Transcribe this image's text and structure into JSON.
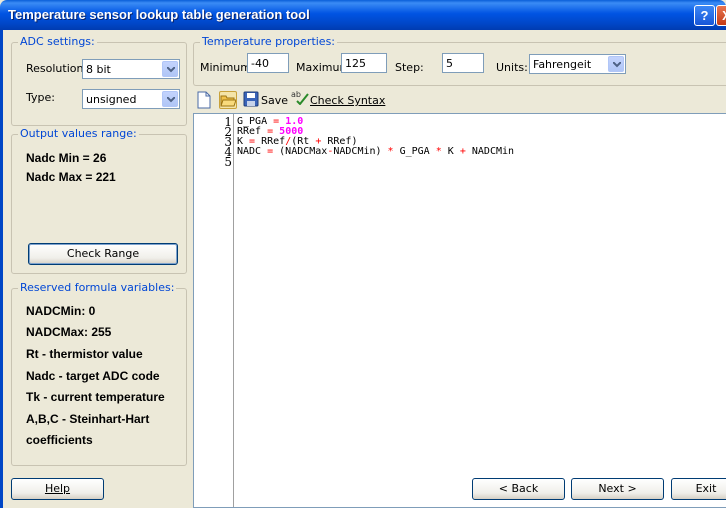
{
  "window": {
    "title": "Temperature sensor lookup table generation tool",
    "help_glyph": "?",
    "close_glyph": "X"
  },
  "adc_settings": {
    "group_title": "ADC settings:",
    "resolution_label": "Resolution:",
    "resolution_value": "8 bit",
    "type_label": "Type:",
    "type_value": "unsigned"
  },
  "output_range": {
    "group_title": "Output values range:",
    "nadc_min": "Nadc Min = 26",
    "nadc_max": "Nadc Max = 221",
    "check_range_label": "Check Range"
  },
  "reserved": {
    "group_title": "Reserved formula variables:",
    "items": [
      "NADCMin: 0",
      "NADCMax: 255",
      "Rt - thermistor value",
      "Nadc - target ADC code",
      "Tk - current temperature",
      "A,B,C - Steinhart-Hart",
      "coefficients"
    ]
  },
  "temperature": {
    "group_title": "Temperature properties:",
    "minimum_label": "Minimum:",
    "minimum_value": "-40",
    "maximum_label": "Maximum:",
    "maximum_value": "125",
    "step_label": "Step:",
    "step_value": "5",
    "units_label": "Units:",
    "units_value": "Fahrengeit"
  },
  "toolbar": {
    "save_label": "Save",
    "check_syntax_label": "Check Syntax",
    "icons": [
      "new-file-icon",
      "open-folder-icon",
      "floppy-disk-icon",
      "spell-check-icon"
    ]
  },
  "editor": {
    "line_numbers": [
      "1",
      "2",
      "3",
      "4",
      "5"
    ],
    "lines": [
      [
        {
          "t": "G_PGA ",
          "c": ""
        },
        {
          "t": "=",
          "c": "op"
        },
        {
          "t": " ",
          "c": ""
        },
        {
          "t": "1.0",
          "c": "num"
        }
      ],
      [
        {
          "t": "RRef ",
          "c": ""
        },
        {
          "t": "=",
          "c": "op"
        },
        {
          "t": " ",
          "c": ""
        },
        {
          "t": "5000",
          "c": "num"
        }
      ],
      [
        {
          "t": "K ",
          "c": ""
        },
        {
          "t": "=",
          "c": "op"
        },
        {
          "t": " RRef",
          "c": ""
        },
        {
          "t": "/",
          "c": "op"
        },
        {
          "t": "(Rt ",
          "c": ""
        },
        {
          "t": "+",
          "c": "op"
        },
        {
          "t": " RRef)",
          "c": ""
        }
      ],
      [
        {
          "t": "NADC ",
          "c": ""
        },
        {
          "t": "=",
          "c": "op"
        },
        {
          "t": " (NADCMax",
          "c": ""
        },
        {
          "t": "-",
          "c": "op"
        },
        {
          "t": "NADCMin) ",
          "c": ""
        },
        {
          "t": "*",
          "c": "op"
        },
        {
          "t": " G_PGA ",
          "c": ""
        },
        {
          "t": "*",
          "c": "op"
        },
        {
          "t": " K ",
          "c": ""
        },
        {
          "t": "+",
          "c": "op"
        },
        {
          "t": " NADCMin",
          "c": ""
        }
      ],
      []
    ]
  },
  "footer": {
    "help_label": "Help",
    "back_label": "< Back",
    "next_label": "Next >",
    "exit_label": "Exit"
  },
  "colors": {
    "titlebar": "#0054e3",
    "group_title": "#0046d5",
    "operator": "#ff0000",
    "number": "#ff00ff"
  }
}
